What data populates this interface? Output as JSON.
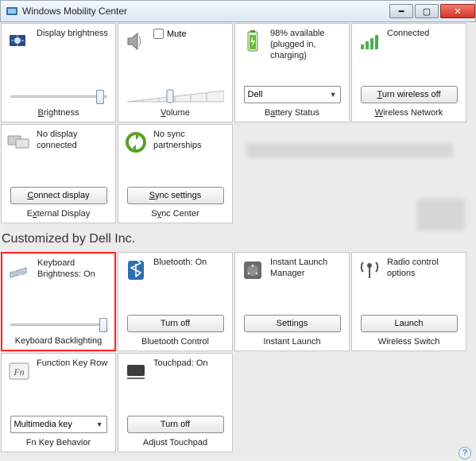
{
  "window": {
    "title": "Windows Mobility Center"
  },
  "tiles": {
    "brightness": {
      "label": "Display brightness",
      "footer": "Brightness",
      "slider_pos": 0.92
    },
    "volume": {
      "mute_label": "Mute",
      "mute_checked": false,
      "footer": "Volume",
      "level": 0.45
    },
    "battery": {
      "label": "98% available (plugged in, charging)",
      "select_value": "Dell",
      "footer": "Battery Status"
    },
    "wireless": {
      "label": "Connected",
      "button": "Turn wireless off",
      "footer": "Wireless Network"
    },
    "ext_display": {
      "label": "No display connected",
      "button": "Connect display",
      "footer": "External Display"
    },
    "sync": {
      "label": "No sync partnerships",
      "button": "Sync settings",
      "footer": "Sync Center"
    }
  },
  "section_header": "Customized by Dell Inc.",
  "dell": {
    "kbd_backlight": {
      "label": "Keyboard Brightness: On",
      "footer": "Keyboard Backlighting",
      "slider_pos": 0.97
    },
    "bluetooth": {
      "label": "Bluetooth: On",
      "button": "Turn off",
      "footer": "Bluetooth Control"
    },
    "instant_launch": {
      "label": "Instant Launch Manager",
      "button": "Settings",
      "footer": "Instant Launch"
    },
    "radio": {
      "label": "Radio control options",
      "button": "Launch",
      "footer": "Wireless Switch"
    },
    "fnkey": {
      "label": "Function Key Row",
      "select_value": "Multimedia key",
      "footer": "Fn Key Behavior"
    },
    "touchpad": {
      "label": "Touchpad: On",
      "button": "Turn off",
      "footer": "Adjust Touchpad"
    }
  }
}
